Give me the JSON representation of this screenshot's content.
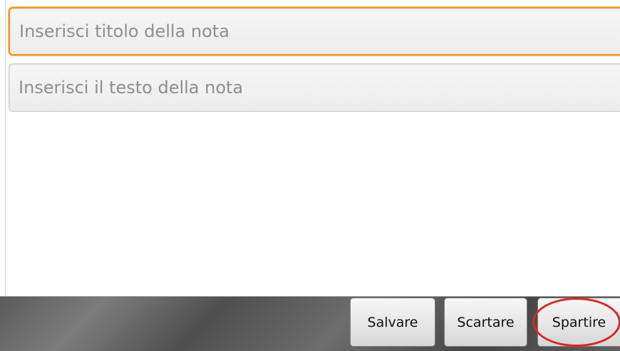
{
  "form": {
    "title_placeholder": "Inserisci titolo della nota",
    "body_placeholder": "Inserisci il testo della nota"
  },
  "actions": {
    "save_label": "Salvare",
    "discard_label": "Scartare",
    "share_label": "Spartire"
  },
  "colors": {
    "focus_border": "#f0961a",
    "highlight_ring": "#e02424"
  }
}
